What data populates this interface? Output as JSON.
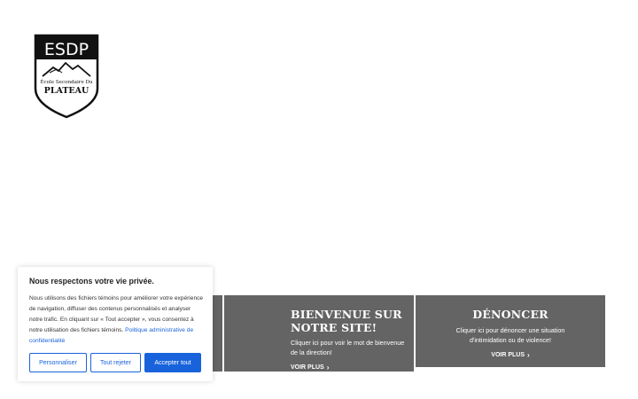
{
  "logo": {
    "top_text": "ESDP",
    "line1": "École Secondaire Du",
    "line2": "PLATEAU"
  },
  "cards": {
    "welcome": {
      "title": "BIENVENUE SUR NOTRE SITE!",
      "text": "Cliquer ici pour voir le mot de bienvenue de la direction!",
      "more": "VOIR PLUS"
    },
    "report": {
      "title": "DÉNONCER",
      "text": "Cliquer ici pour dénoncer une situation d'intimidation ou de violence!",
      "more": "VOIR PLUS"
    }
  },
  "consent": {
    "title": "Nous respectons votre vie privée.",
    "body": "Nous utilisons des fichiers témoins pour améliorer votre expérience de navigation, diffuser des contenus personnalisés et analyser notre trafic. En cliquant sur « Tout accepter », vous consentez à notre utilisation des fichiers témoins.",
    "link": "Politique administrative de confidentialité",
    "customize_label": "Personnaliser",
    "reject_label": "Tout rejeter",
    "accept_label": "Accepter tout"
  },
  "colors": {
    "card_bg": "#646464",
    "accent": "#1863dc",
    "text": "#333333"
  }
}
